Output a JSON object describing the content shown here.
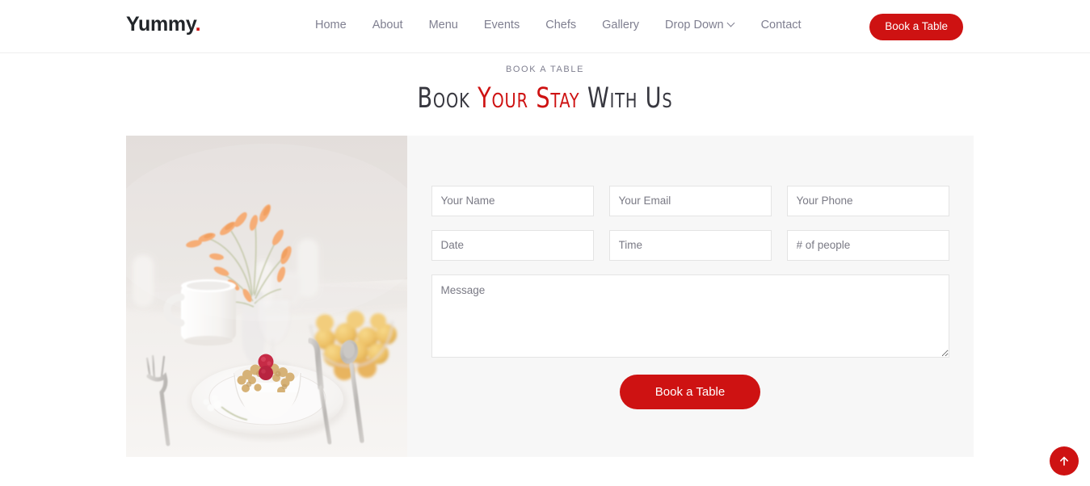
{
  "header": {
    "logo_text": "Yummy",
    "logo_dot": ".",
    "nav": [
      {
        "label": "Home",
        "icon": null
      },
      {
        "label": "About",
        "icon": null
      },
      {
        "label": "Menu",
        "icon": null
      },
      {
        "label": "Events",
        "icon": null
      },
      {
        "label": "Chefs",
        "icon": null
      },
      {
        "label": "Gallery",
        "icon": null
      },
      {
        "label": "Drop Down",
        "icon": "chevron-down-icon"
      },
      {
        "label": "Contact",
        "icon": null
      }
    ],
    "cta_label": "Book a Table"
  },
  "section": {
    "eyebrow": "BOOK A TABLE",
    "heading_part1": "Book ",
    "heading_accent": "Your Stay",
    "heading_part2": " With Us"
  },
  "form": {
    "name_placeholder": "Your Name",
    "email_placeholder": "Your Email",
    "phone_placeholder": "Your Phone",
    "date_placeholder": "Date",
    "time_placeholder": "Time",
    "people_placeholder": "# of people",
    "message_placeholder": "Message",
    "submit_label": "Book a Table",
    "name_value": "",
    "email_value": "",
    "phone_value": "",
    "date_value": "",
    "time_value": "",
    "people_value": "",
    "message_value": ""
  },
  "photo": {
    "alt": "Table setting with orange flowers, bowl of yellow fruit, granola parfait with raspberries, fork, knife and spoon"
  },
  "scroll_top": {
    "icon": "arrow-up-icon"
  },
  "colors": {
    "accent_red": "#ce1212",
    "heading_dark": "#37373f",
    "nav_gray": "#7f7f90",
    "panel_bg": "#f7f7f7",
    "field_border": "#e4e4e4"
  }
}
